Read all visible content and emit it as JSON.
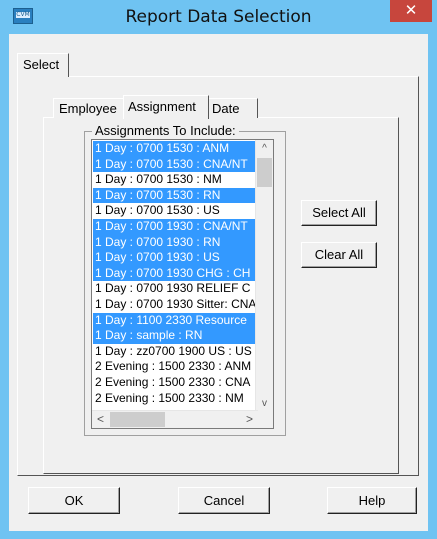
{
  "window": {
    "title": "Report Data Selection",
    "close_glyph": "✕",
    "icon_name": "app-icon",
    "icon_text": "CVM"
  },
  "tabs": {
    "outer": "Select",
    "inner": [
      "Employee",
      "Assignment",
      "Date"
    ],
    "active_inner": "Assignment"
  },
  "assignments": {
    "group_label": "Assignments To Include:",
    "items": [
      {
        "text": "1 Day : 0700 1530 : ANM",
        "selected": true
      },
      {
        "text": "1 Day : 0700 1530 : CNA/NT",
        "selected": true
      },
      {
        "text": "1 Day : 0700 1530 : NM",
        "selected": false
      },
      {
        "text": "1 Day : 0700 1530 : RN",
        "selected": true
      },
      {
        "text": "1 Day : 0700 1530 : US",
        "selected": false
      },
      {
        "text": "1 Day : 0700 1930 : CNA/NT",
        "selected": true
      },
      {
        "text": "1 Day : 0700 1930 : RN",
        "selected": true
      },
      {
        "text": "1 Day : 0700 1930 : US",
        "selected": true
      },
      {
        "text": "1 Day : 0700 1930 CHG : CH",
        "selected": true
      },
      {
        "text": "1 Day : 0700 1930 RELIEF C",
        "selected": false
      },
      {
        "text": "1 Day : 0700 1930 Sitter: CNA",
        "selected": false
      },
      {
        "text": "1 Day : 1100 2330 Resource",
        "selected": true
      },
      {
        "text": "1 Day : sample : RN",
        "selected": true
      },
      {
        "text": "1 Day : zz0700 1900 US : US",
        "selected": false
      },
      {
        "text": "2 Evening : 1500 2330 : ANM",
        "selected": false
      },
      {
        "text": "2 Evening : 1500 2330 : CNA",
        "selected": false
      },
      {
        "text": "2 Evening : 1500 2330 : NM",
        "selected": false
      }
    ],
    "scroll_up": "^",
    "scroll_down": "v",
    "scroll_left": "<",
    "scroll_right": ">"
  },
  "buttons": {
    "select_all": "Select All",
    "clear_all": "Clear All",
    "ok": "OK",
    "cancel": "Cancel",
    "help": "Help"
  },
  "colors": {
    "titlebar": "#6fc3f2",
    "close": "#c7463d",
    "selection": "#3399ff"
  }
}
